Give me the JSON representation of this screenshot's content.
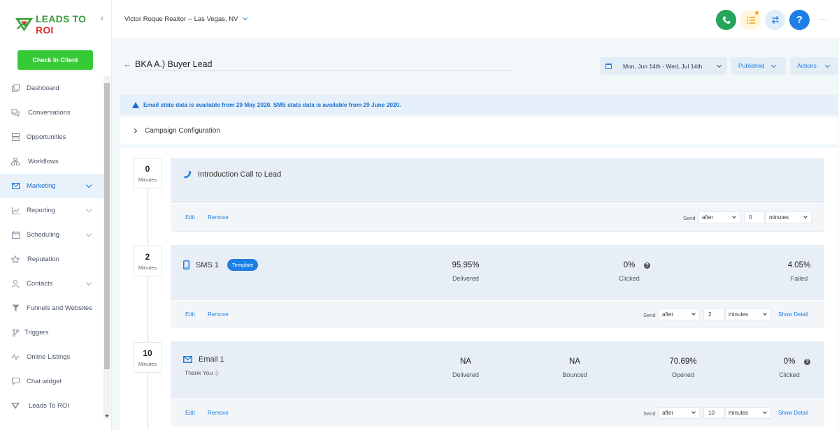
{
  "brand": {
    "name_part1": "LEADS TO",
    "name_part2": "ROI"
  },
  "sidebar": {
    "checkin_label": "Check In Client",
    "items": [
      {
        "label": "Dashboard",
        "icon": "dashboard-icon",
        "has_chevron": false
      },
      {
        "label": "Conversations",
        "icon": "chat-bubbles-icon",
        "has_chevron": false
      },
      {
        "label": "Opportunities",
        "icon": "layers-icon",
        "has_chevron": false
      },
      {
        "label": "Workflows",
        "icon": "sitemap-icon",
        "has_chevron": false
      },
      {
        "label": "Marketing",
        "icon": "envelope-icon",
        "has_chevron": true,
        "active": true
      },
      {
        "label": "Reporting",
        "icon": "chart-line-icon",
        "has_chevron": true
      },
      {
        "label": "Scheduling",
        "icon": "calendar-icon",
        "has_chevron": true
      },
      {
        "label": "Reputation",
        "icon": "star-icon",
        "has_chevron": false
      },
      {
        "label": "Contacts",
        "icon": "user-icon",
        "has_chevron": true
      },
      {
        "label": "Funnels and Websites",
        "icon": "funnel-icon",
        "has_chevron": true
      },
      {
        "label": "Triggers",
        "icon": "branch-icon",
        "has_chevron": false
      },
      {
        "label": "Online Listings",
        "icon": "pulse-icon",
        "has_chevron": false
      },
      {
        "label": "Chat widget",
        "icon": "chat-box-icon",
        "has_chevron": false
      },
      {
        "label": "Leads To ROI",
        "icon": "leads-logo-icon",
        "has_chevron": false
      }
    ]
  },
  "topbar": {
    "account": "Victor Roque Realtor -- Las Vegas, NV",
    "help_label": "?",
    "more_label": "···"
  },
  "header": {
    "back": "←",
    "campaign_name": "BKA A.) Buyer Lead",
    "date_range": "Mon, Jun 14th - Wed, Jul 14th",
    "status": "Published",
    "actions": "Actions"
  },
  "info_message": "Email stats data is available from 29 May 2020. SMS stats data is available from 29 June 2020.",
  "config_label": "Campaign Configuration",
  "steps": [
    {
      "delay": "0",
      "delay_unit": "Minutes",
      "title": "Introduction Call to Lead",
      "icon": "phone-icon",
      "edit": "Edit",
      "remove": "Remove",
      "send_label": "Send",
      "send_when": "after",
      "send_amount": "0",
      "send_unit": "minutes"
    },
    {
      "delay": "2",
      "delay_unit": "Minutes",
      "title": "SMS 1",
      "badge": "Template",
      "icon": "mobile-icon",
      "stats": [
        {
          "value": "95.95%",
          "label": "Delivered"
        },
        {
          "value": "0%",
          "label": "Clicked"
        },
        {
          "value": "4.05%",
          "label": "Failed"
        }
      ],
      "edit": "Edit",
      "remove": "Remove",
      "send_label": "Send",
      "send_when": "after",
      "send_amount": "2",
      "send_unit": "minutes",
      "show_detail": "Show Detail"
    },
    {
      "delay": "10",
      "delay_unit": "Minutes",
      "title": "Email 1",
      "subtitle": "Thank You :)",
      "icon": "mail-icon",
      "stats": [
        {
          "value": "NA",
          "label": "Delivered"
        },
        {
          "value": "NA",
          "label": "Bounced"
        },
        {
          "value": "70.69%",
          "label": "Opened"
        },
        {
          "value": "0%",
          "label": "Clicked"
        }
      ],
      "edit": "Edit",
      "remove": "Remove",
      "send_label": "Send",
      "send_when": "after",
      "send_amount": "10",
      "send_unit": "minutes",
      "show_detail": "Show Detail"
    }
  ],
  "colors": {
    "accent": "#1d7fe4",
    "checkin": "#37ca37",
    "phone": "#23a65a"
  }
}
